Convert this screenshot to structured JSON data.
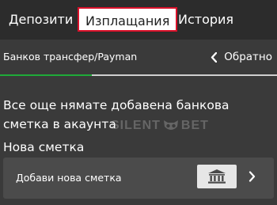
{
  "tabs": {
    "deposits": "Депозити",
    "withdrawals": "Изплащания",
    "history": "История",
    "active": "withdrawals"
  },
  "method": {
    "label": "Банков трансфер/Payman",
    "back_label": "Обратно"
  },
  "progress": {
    "fraction": 0.33
  },
  "content": {
    "message": "Все още нямате добавена банкова сметка в акаунта",
    "section_label": "Нова сметка",
    "add_account_label": "Добави нова сметка"
  },
  "watermark": {
    "left": "SILENT",
    "right": "BET"
  },
  "icons": {
    "back": "chevron-left-icon",
    "bank": "bank-icon",
    "forward": "chevron-right-icon"
  },
  "colors": {
    "active_tab_border": "#d9112a",
    "progress": "#1faa39",
    "background": "#3a3a3a",
    "tab_bar": "#2c2c2c"
  }
}
